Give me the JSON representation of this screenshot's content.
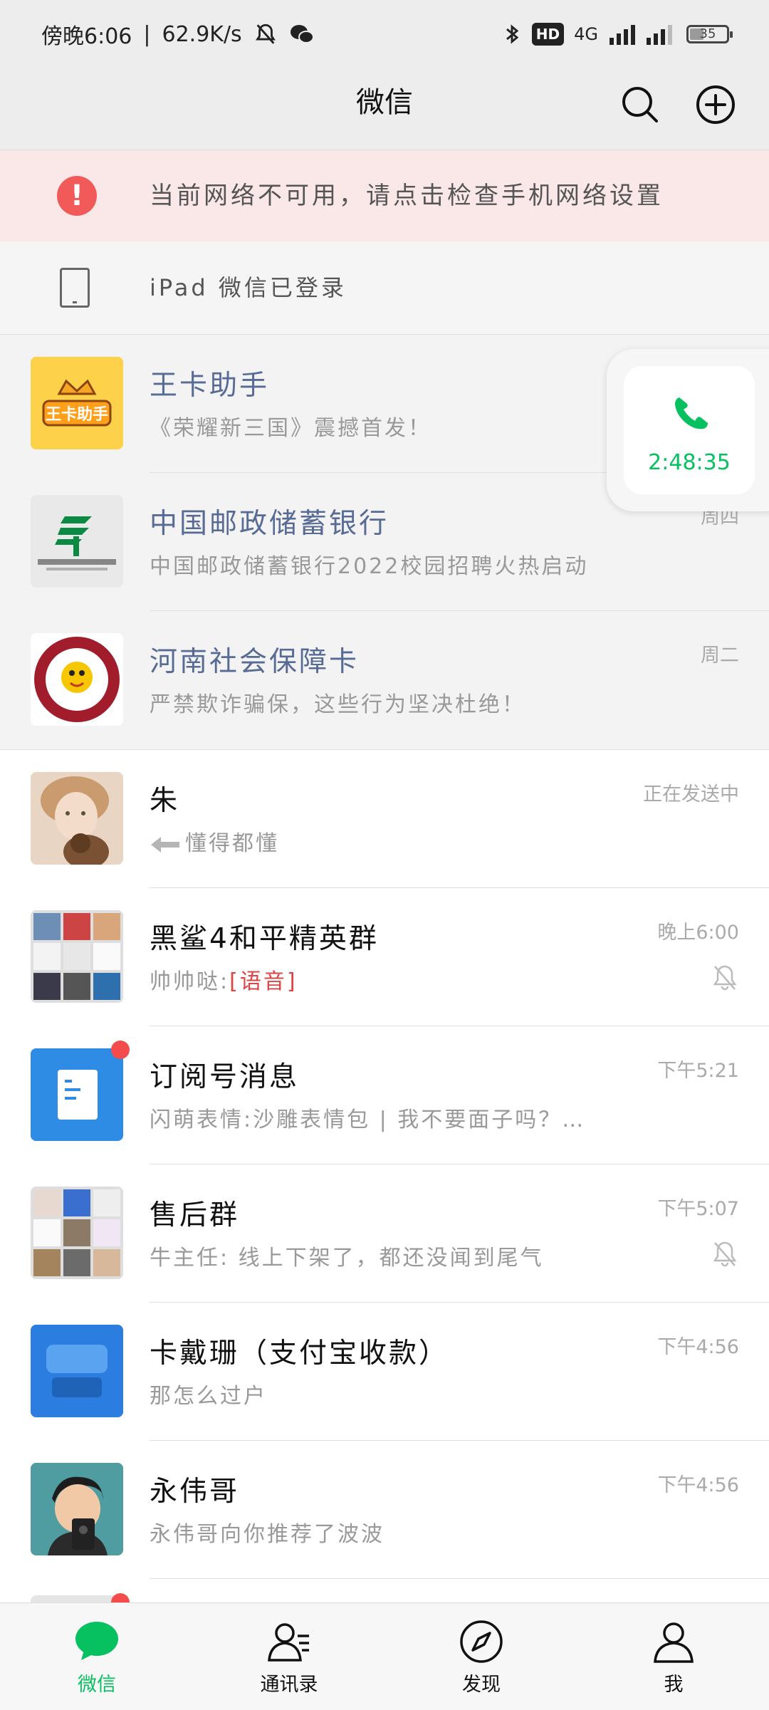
{
  "status_bar": {
    "time": "傍晚6:06",
    "speed": "62.9K/s",
    "hd": "HD",
    "network": "4G",
    "battery": "35"
  },
  "header": {
    "title": "微信",
    "search_icon": "search-icon",
    "add_icon": "plus-circle-icon"
  },
  "banner": {
    "network_warning": "当前网络不可用，请点击检查手机网络设置",
    "ipad_login": "iPad 微信已登录"
  },
  "chats": [
    {
      "name": "王卡助手",
      "preview": "《荣耀新三国》震撼首发！",
      "time": "",
      "pinned": true,
      "official": true
    },
    {
      "name": "中国邮政储蓄银行",
      "preview": "中国邮政储蓄银行2022校园招聘火热启动",
      "time": "周四",
      "pinned": true,
      "official": true
    },
    {
      "name": "河南社会保障卡",
      "preview": "严禁欺诈骗保，这些行为坚决杜绝！",
      "time": "周二",
      "pinned": true,
      "official": true
    },
    {
      "name": "朱",
      "preview": "懂得都懂",
      "time": "正在发送中"
    },
    {
      "name": "黑鲨4和平精英群",
      "preview_prefix": "帅帅哒:",
      "preview": "[语音]",
      "time": "晚上6:00",
      "muted": true
    },
    {
      "name": "订阅号消息",
      "preview": "闪萌表情:沙雕表情包 | 我不要面子吗？…",
      "time": "下午5:21",
      "unread": true
    },
    {
      "name": "售后群",
      "preview": "牛主任: 线上下架了，都还没闻到尾气",
      "time": "下午5:07",
      "muted": true
    },
    {
      "name": "卡戴珊（支付宝收款）",
      "preview": "那怎么过户",
      "time": "下午4:56"
    },
    {
      "name": "永伟哥",
      "preview": "永伟哥向你推荐了波波",
      "time": "下午4:56"
    }
  ],
  "floating_call": {
    "duration": "2:48:35"
  },
  "tabs": [
    {
      "label": "微信",
      "active": true
    },
    {
      "label": "通讯录"
    },
    {
      "label": "发现"
    },
    {
      "label": "我"
    }
  ],
  "colors": {
    "accent": "#07c160",
    "official_name": "#576b95",
    "warning_bg": "#fae8e8",
    "unread_dot": "#f34c4c"
  }
}
